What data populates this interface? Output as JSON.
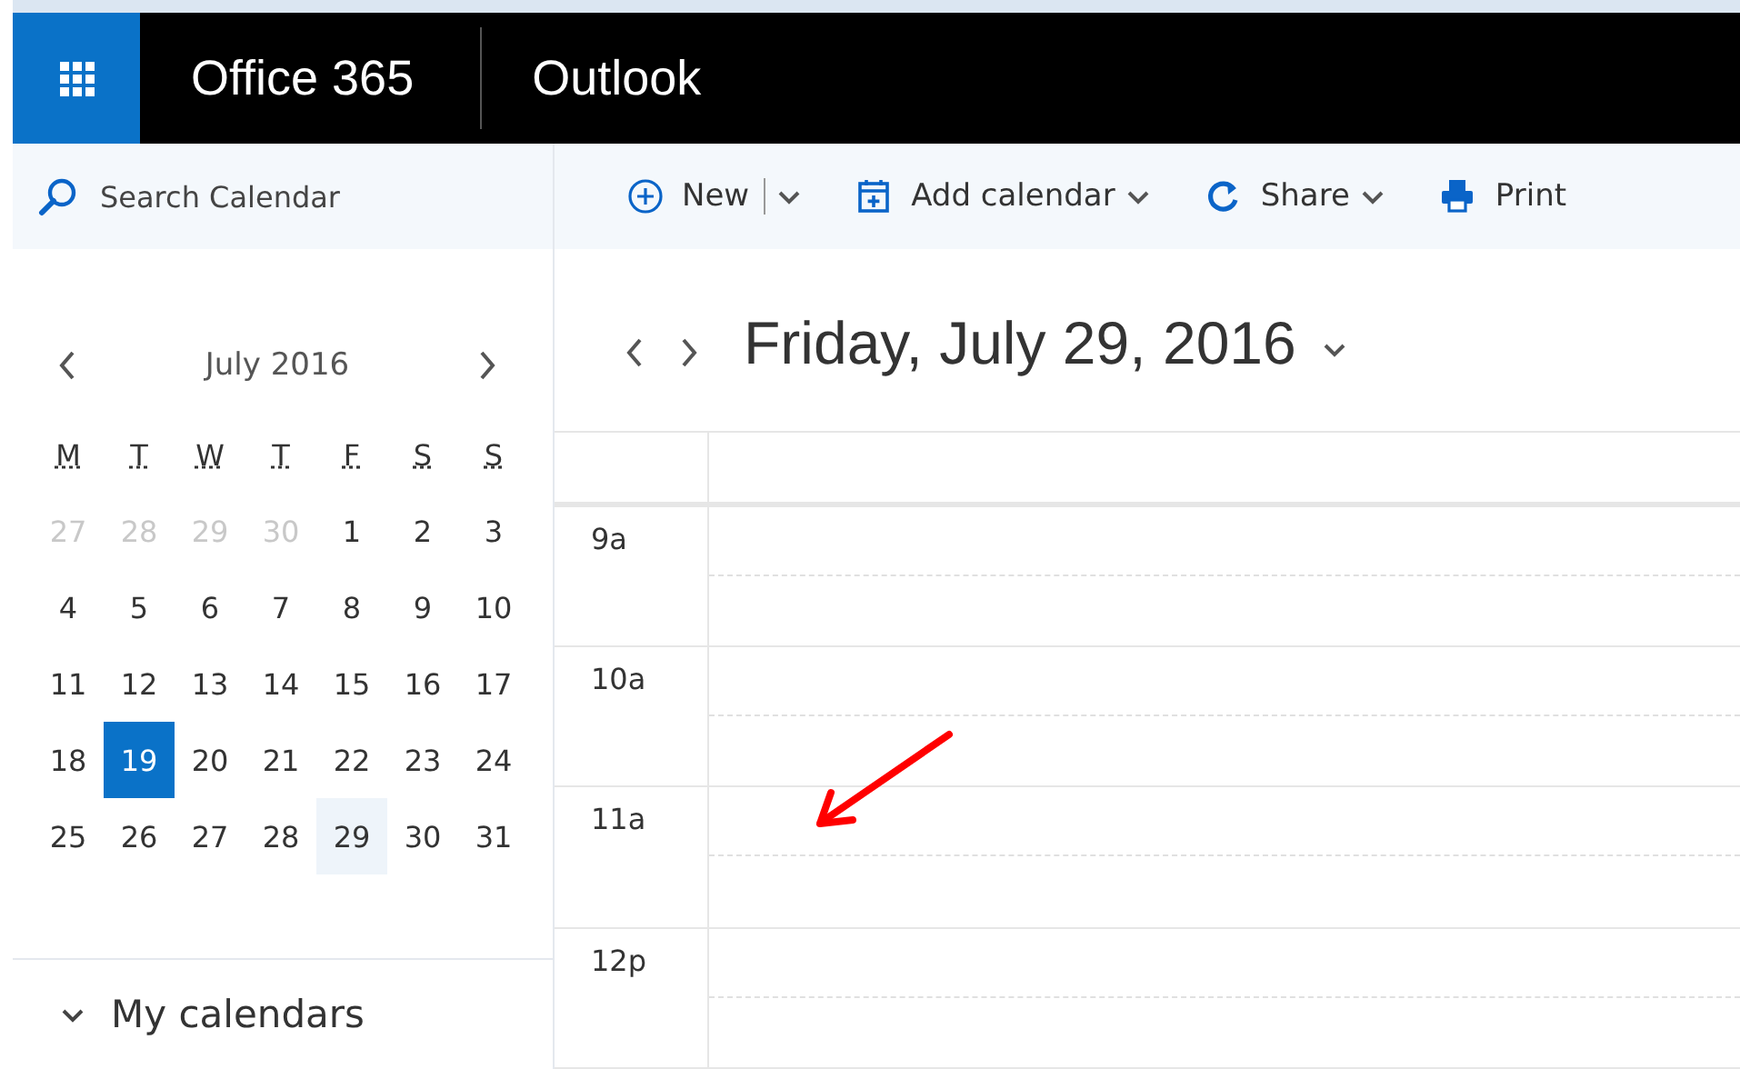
{
  "header": {
    "product": "Office 365",
    "app": "Outlook"
  },
  "search": {
    "placeholder": "Search Calendar"
  },
  "toolbar": [
    {
      "kind": "new",
      "label": "New",
      "dropdown": true,
      "split": true
    },
    {
      "kind": "add",
      "label": "Add calendar",
      "dropdown": true,
      "split": false
    },
    {
      "kind": "share",
      "label": "Share",
      "dropdown": true,
      "split": false
    },
    {
      "kind": "print",
      "label": "Print",
      "dropdown": false,
      "split": false
    }
  ],
  "mini_calendar": {
    "month": "July 2016",
    "weekdays": [
      "M",
      "T",
      "W",
      "T",
      "F",
      "S",
      "S"
    ],
    "days": [
      {
        "label": "27",
        "outside": true,
        "selected": false,
        "viewed": false
      },
      {
        "label": "28",
        "outside": true,
        "selected": false,
        "viewed": false
      },
      {
        "label": "29",
        "outside": true,
        "selected": false,
        "viewed": false
      },
      {
        "label": "30",
        "outside": true,
        "selected": false,
        "viewed": false
      },
      {
        "label": "1",
        "outside": false,
        "selected": false,
        "viewed": false
      },
      {
        "label": "2",
        "outside": false,
        "selected": false,
        "viewed": false
      },
      {
        "label": "3",
        "outside": false,
        "selected": false,
        "viewed": false
      },
      {
        "label": "4",
        "outside": false,
        "selected": false,
        "viewed": false
      },
      {
        "label": "5",
        "outside": false,
        "selected": false,
        "viewed": false
      },
      {
        "label": "6",
        "outside": false,
        "selected": false,
        "viewed": false
      },
      {
        "label": "7",
        "outside": false,
        "selected": false,
        "viewed": false
      },
      {
        "label": "8",
        "outside": false,
        "selected": false,
        "viewed": false
      },
      {
        "label": "9",
        "outside": false,
        "selected": false,
        "viewed": false
      },
      {
        "label": "10",
        "outside": false,
        "selected": false,
        "viewed": false
      },
      {
        "label": "11",
        "outside": false,
        "selected": false,
        "viewed": false
      },
      {
        "label": "12",
        "outside": false,
        "selected": false,
        "viewed": false
      },
      {
        "label": "13",
        "outside": false,
        "selected": false,
        "viewed": false
      },
      {
        "label": "14",
        "outside": false,
        "selected": false,
        "viewed": false
      },
      {
        "label": "15",
        "outside": false,
        "selected": false,
        "viewed": false
      },
      {
        "label": "16",
        "outside": false,
        "selected": false,
        "viewed": false
      },
      {
        "label": "17",
        "outside": false,
        "selected": false,
        "viewed": false
      },
      {
        "label": "18",
        "outside": false,
        "selected": false,
        "viewed": false
      },
      {
        "label": "19",
        "outside": false,
        "selected": true,
        "viewed": false
      },
      {
        "label": "20",
        "outside": false,
        "selected": false,
        "viewed": false
      },
      {
        "label": "21",
        "outside": false,
        "selected": false,
        "viewed": false
      },
      {
        "label": "22",
        "outside": false,
        "selected": false,
        "viewed": false
      },
      {
        "label": "23",
        "outside": false,
        "selected": false,
        "viewed": false
      },
      {
        "label": "24",
        "outside": false,
        "selected": false,
        "viewed": false
      },
      {
        "label": "25",
        "outside": false,
        "selected": false,
        "viewed": false
      },
      {
        "label": "26",
        "outside": false,
        "selected": false,
        "viewed": false
      },
      {
        "label": "27",
        "outside": false,
        "selected": false,
        "viewed": false
      },
      {
        "label": "28",
        "outside": false,
        "selected": false,
        "viewed": false
      },
      {
        "label": "29",
        "outside": false,
        "selected": false,
        "viewed": true
      },
      {
        "label": "30",
        "outside": false,
        "selected": false,
        "viewed": false
      },
      {
        "label": "31",
        "outside": false,
        "selected": false,
        "viewed": false
      }
    ]
  },
  "my_calendars": {
    "label": "My calendars",
    "expanded": true
  },
  "day_view": {
    "title": "Friday, July 29, 2016",
    "hours": [
      "9a",
      "10a",
      "11a",
      "12p"
    ]
  }
}
